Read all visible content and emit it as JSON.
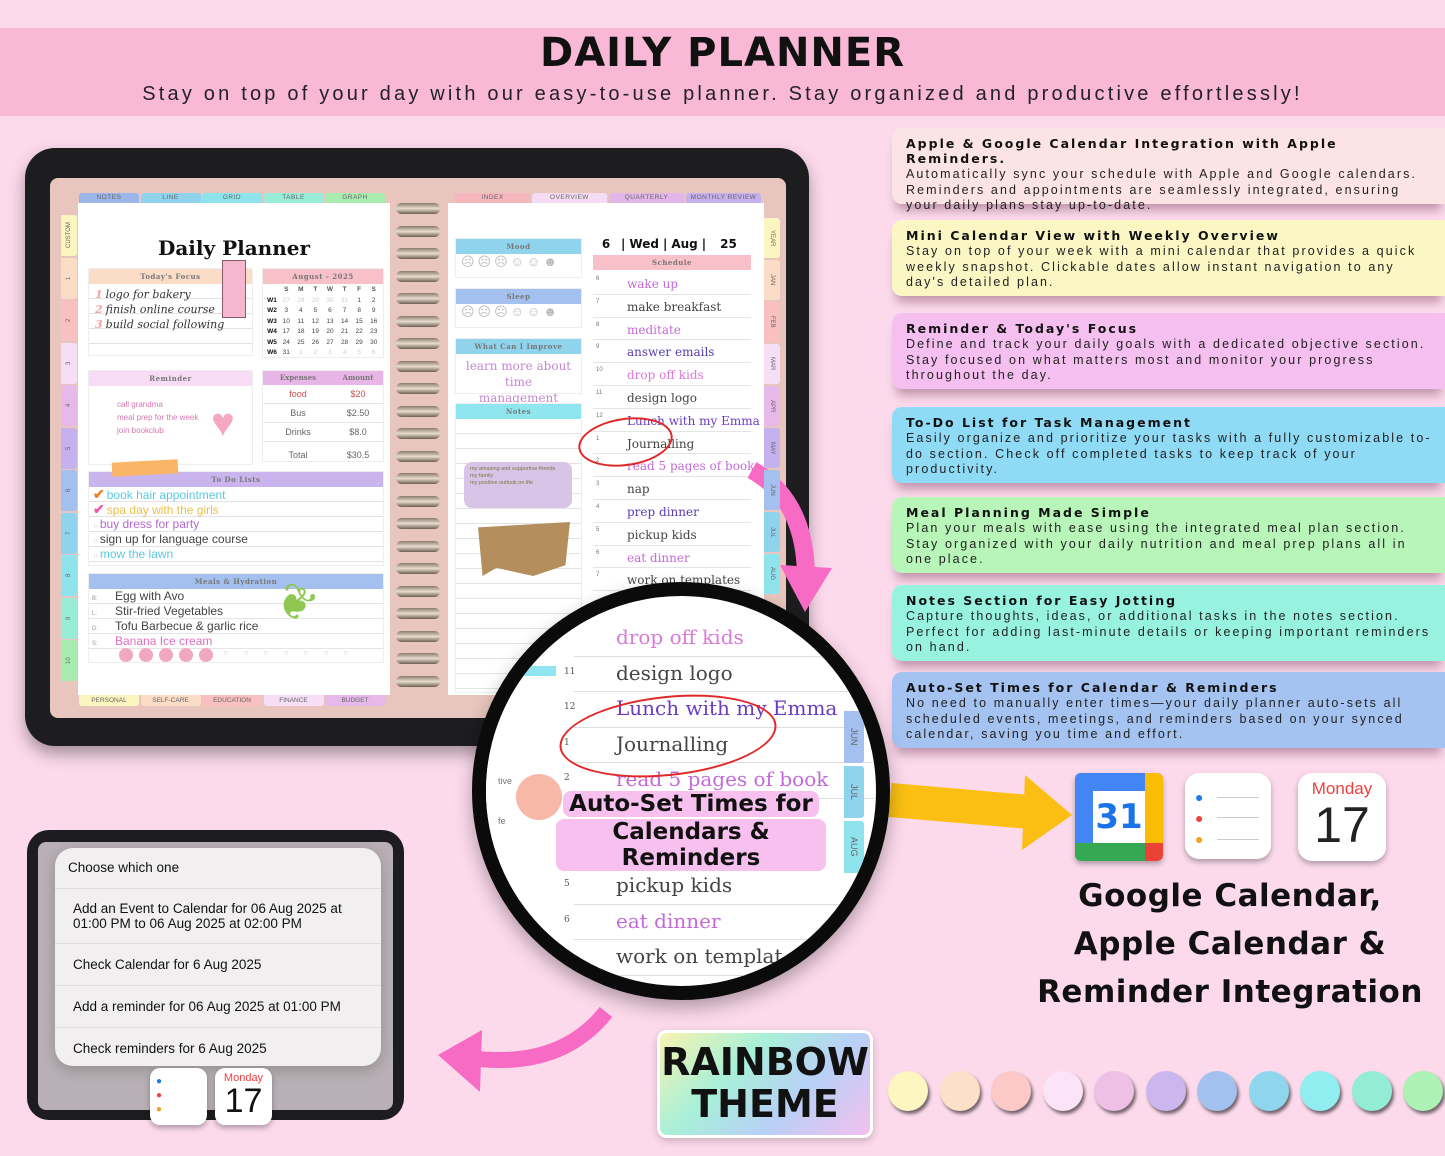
{
  "header": {
    "title": "DAILY PLANNER",
    "subtitle": "Stay on top of your day with our easy-to-use planner. Stay organized and productive effortlessly!"
  },
  "features": [
    {
      "title": "Apple & Google Calendar Integration with Apple Reminders.",
      "text": "Automatically sync your schedule with Apple and Google calendars. Reminders and appointments are seamlessly integrated, ensuring your daily plans stay up-to-date.",
      "color": "#fde4e4"
    },
    {
      "title": "Mini Calendar View with Weekly Overview",
      "text": "Stay on top of your week with a mini calendar that provides a quick weekly snapshot. Clickable dates allow instant navigation to any day's detailed plan.",
      "color": "#fbf7c5"
    },
    {
      "title": "Reminder & Today's Focus",
      "text": "Define and track your daily goals with a dedicated objective section. Stay focused on what matters most and monitor your progress throughout the day.",
      "color": "#f5bff0"
    },
    {
      "title": "To-Do List for Task Management",
      "text": "Easily organize and prioritize your tasks with a fully customizable to-do section. Check off completed tasks to keep track of your productivity.",
      "color": "#8fdaf4"
    },
    {
      "title": "Meal Planning Made Simple",
      "text": "Plan your meals with ease using the integrated meal plan section. Stay organized with your daily nutrition and meal prep plans all in one place.",
      "color": "#b8f5b8"
    },
    {
      "title": "Notes Section for Easy Jotting",
      "text": "Capture thoughts, ideas, or additional tasks in the notes section. Perfect for adding last-minute details or keeping important reminders on hand.",
      "color": "#98f2e0"
    },
    {
      "title": "Auto-Set Times for Calendar & Reminders",
      "text": "No need to manually enter times—your daily planner auto-sets all scheduled events, meetings, and reminders based on your synced calendar, saving you time and effort.",
      "color": "#a4c3f0"
    }
  ],
  "planner": {
    "top_tabs_left": [
      {
        "label": "NOTES",
        "color": "#9cb6ea"
      },
      {
        "label": "LINE",
        "color": "#8fd3ec"
      },
      {
        "label": "GRID",
        "color": "#8fe3ec"
      },
      {
        "label": "TABLE",
        "color": "#98ecd8"
      },
      {
        "label": "GRAPH",
        "color": "#a9ecb0"
      }
    ],
    "top_tabs_right": [
      {
        "label": "INDEX",
        "color": "#f6b6bd"
      },
      {
        "label": "OVERVIEW",
        "color": "#f6dcf3"
      },
      {
        "label": "QUARTERLY",
        "color": "#e3b6ea"
      },
      {
        "label": "MONTHLY REVIEW",
        "color": "#c4b1ee"
      }
    ],
    "bottom_tabs": [
      {
        "label": "PERSONAL",
        "color": "#fbf5c0"
      },
      {
        "label": "SELF-CARE",
        "color": "#fbdcc6"
      },
      {
        "label": "EDUCATION",
        "color": "#f8c0c0"
      },
      {
        "label": "FINANCE",
        "color": "#f6dff6"
      },
      {
        "label": "BUDGET",
        "color": "#e6b9e8"
      }
    ],
    "left_tabs": [
      {
        "label": "CUSTOM",
        "color": "#fbf5c0"
      },
      {
        "label": "1",
        "color": "#fbdcc6"
      },
      {
        "label": "2",
        "color": "#f8c0c0"
      },
      {
        "label": "3",
        "color": "#f6dff6"
      },
      {
        "label": "4",
        "color": "#e6b9e8"
      },
      {
        "label": "5",
        "color": "#c4b1ee"
      },
      {
        "label": "6",
        "color": "#a3c0ee"
      },
      {
        "label": "7",
        "color": "#8fd3ec"
      },
      {
        "label": "8",
        "color": "#8fe3ec"
      },
      {
        "label": "9",
        "color": "#98ecd8"
      },
      {
        "label": "10",
        "color": "#a9ecb0"
      }
    ],
    "right_tabs": [
      {
        "label": "YEAR",
        "color": "#fbf5c0"
      },
      {
        "label": "JAN",
        "color": "#fbdcc6"
      },
      {
        "label": "FEB",
        "color": "#f8c0c0"
      },
      {
        "label": "MAR",
        "color": "#f6dff6"
      },
      {
        "label": "APR",
        "color": "#e6b9e8"
      },
      {
        "label": "MAY",
        "color": "#c4b1ee"
      },
      {
        "label": "JUN",
        "color": "#a3c0ee"
      },
      {
        "label": "JUL",
        "color": "#8fd3ec"
      },
      {
        "label": "AUG",
        "color": "#8fe3ec"
      }
    ],
    "page_title": "Daily Planner",
    "focus": {
      "title": "Today's Focus",
      "items": [
        "logo for bakery",
        "finish online course",
        "build social following"
      ]
    },
    "calendar": {
      "title": "August - 2025",
      "days": [
        "S",
        "M",
        "T",
        "W",
        "T",
        "F",
        "S"
      ],
      "weeks": [
        {
          "label": "W1",
          "dates": [
            "27",
            "28",
            "29",
            "30",
            "31",
            "1",
            "2"
          ]
        },
        {
          "label": "W2",
          "dates": [
            "3",
            "4",
            "5",
            "6",
            "7",
            "8",
            "9"
          ]
        },
        {
          "label": "W3",
          "dates": [
            "10",
            "11",
            "12",
            "13",
            "14",
            "15",
            "16"
          ]
        },
        {
          "label": "W4",
          "dates": [
            "17",
            "18",
            "19",
            "20",
            "21",
            "22",
            "23"
          ]
        },
        {
          "label": "W5",
          "dates": [
            "24",
            "25",
            "26",
            "27",
            "28",
            "29",
            "30"
          ]
        },
        {
          "label": "W6",
          "dates": [
            "31",
            "1",
            "2",
            "3",
            "4",
            "5",
            "6"
          ]
        }
      ]
    },
    "reminder": {
      "title": "Reminder",
      "items": [
        "call grandma",
        "meal prep for the week",
        "join bookclub"
      ]
    },
    "expenses": {
      "col1": "Expenses",
      "col2": "Amount",
      "rows": [
        {
          "item": "food",
          "amount": "$20"
        },
        {
          "item": "Bus",
          "amount": "$2.50"
        },
        {
          "item": "Drinks",
          "amount": "$8.0"
        }
      ],
      "total_label": "Total",
      "total": "$30.5"
    },
    "todo": {
      "title": "To Do Lists",
      "items": [
        {
          "text": "book hair appointment",
          "done": true,
          "color": "#5cc8e0"
        },
        {
          "text": "spa day with the girls",
          "done": true,
          "color": "#e8c04a"
        },
        {
          "text": "buy dress for party",
          "done": false,
          "color": "#b36ad0"
        },
        {
          "text": "sign up for language course",
          "done": false,
          "color": "#444444"
        },
        {
          "text": "mow the lawn",
          "done": false,
          "color": "#5cc8e0"
        }
      ]
    },
    "meals": {
      "title": "Meals & Hydration",
      "rows": [
        {
          "key": "B:",
          "text": "Egg with Avo"
        },
        {
          "key": "L:",
          "text": "Stir-fried Vegetables"
        },
        {
          "key": "D:",
          "text": "Tofu Barbecue & garlic rice"
        },
        {
          "key": "S:",
          "text": "Banana Ice cream"
        }
      ],
      "water_filled": 5,
      "water_total": 12
    },
    "mood": {
      "title": "Mood"
    },
    "sleep": {
      "title": "Sleep"
    },
    "improve": {
      "title": "What Can I Improve",
      "text": "learn more about time management"
    },
    "notes": {
      "title": "Notes",
      "items": [
        "my amazing and supportive friends",
        "my family",
        "my positive outlook on life"
      ]
    },
    "date": {
      "day": "6",
      "weekday": "Wed",
      "month": "Aug",
      "year": "25"
    },
    "schedule": {
      "title": "Schedule",
      "rows": [
        {
          "hour": "6",
          "text": "wake up",
          "color": "#c46ad8"
        },
        {
          "hour": "7",
          "text": "make breakfast",
          "color": "#444444"
        },
        {
          "hour": "8",
          "text": "meditate",
          "color": "#c46ad8"
        },
        {
          "hour": "9",
          "text": "answer emails",
          "color": "#5a3cb0"
        },
        {
          "hour": "10",
          "text": "drop off kids",
          "color": "#d87ad8"
        },
        {
          "hour": "11",
          "text": "design logo",
          "color": "#444444"
        },
        {
          "hour": "12",
          "text": "Lunch with my Emma",
          "color": "#6a3cc0"
        },
        {
          "hour": "1",
          "text": "Journalling",
          "color": "#444444"
        },
        {
          "hour": "2",
          "text": "read 5 pages of book",
          "color": "#c46ad8"
        },
        {
          "hour": "3",
          "text": "nap",
          "color": "#444444"
        },
        {
          "hour": "4",
          "text": "prep dinner",
          "color": "#5a3cb0"
        },
        {
          "hour": "5",
          "text": "pickup kids",
          "color": "#444444"
        },
        {
          "hour": "6",
          "text": "eat dinner",
          "color": "#c46ad8"
        },
        {
          "hour": "7",
          "text": "work on templates",
          "color": "#444444"
        }
      ]
    }
  },
  "magnifier": {
    "badge_line1": "Auto-Set Times for",
    "badge_line2": "Calendars & Reminders",
    "side_tabs": [
      "JUN",
      "JUL",
      "AUG"
    ],
    "left_fragment1": "tive",
    "left_fragment2": "fe",
    "rows_top": [
      {
        "hour": "",
        "text": "drop off kids",
        "color": "#d87ad8"
      },
      {
        "hour": "11",
        "text": "design logo",
        "color": "#444444"
      },
      {
        "hour": "12",
        "text": "Lunch with my Emma",
        "color": "#6a3cc0"
      },
      {
        "hour": "1",
        "text": "Journalling",
        "color": "#444444"
      },
      {
        "hour": "2",
        "text": "read 5 pages of book",
        "color": "#c46ad8"
      }
    ],
    "rows_bottom": [
      {
        "hour": "5",
        "text": "pickup kids",
        "color": "#444444"
      },
      {
        "hour": "6",
        "text": "eat dinner",
        "color": "#c46ad8"
      },
      {
        "hour": "7",
        "text": "work on templat",
        "color": "#444444"
      }
    ]
  },
  "dialog": {
    "title": "Choose which one",
    "options": [
      "Add an Event to Calendar for 06 Aug 2025 at 01:00 PM to 06 Aug 2025 at 02:00 PM",
      "Check Calendar for 6 Aug 2025",
      "Add a reminder for 06 Aug 2025 at 01:00 PM",
      "Check reminders for 6 Aug 2025"
    ]
  },
  "icons": {
    "google_calendar_date": "31",
    "apple_calendar_weekday": "Monday",
    "apple_calendar_day": "17"
  },
  "integration": {
    "line1": "Google Calendar,",
    "line2": "Apple Calendar &",
    "line3": "Reminder Integration"
  },
  "theme": {
    "line1": "RAINBOW",
    "line2": "THEME",
    "swatches": [
      "#fdf6c0",
      "#fde0c8",
      "#fcc8c8",
      "#fce4f8",
      "#efc0e6",
      "#cbb6ee",
      "#a3c1ee",
      "#8ed6ee",
      "#90eef0",
      "#92ecd6",
      "#acf2b4"
    ]
  }
}
